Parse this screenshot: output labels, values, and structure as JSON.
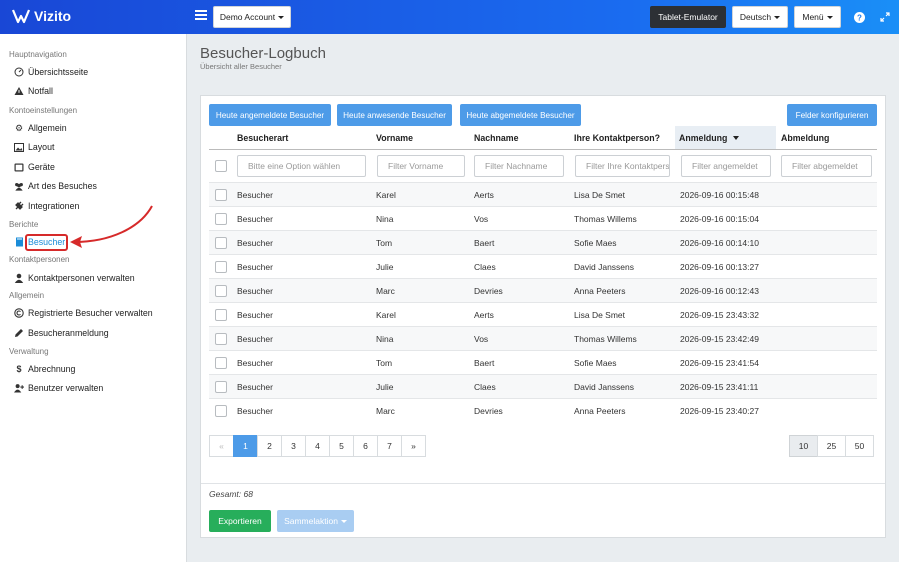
{
  "app": {
    "name": "Vizito"
  },
  "topbar": {
    "account_label": "Demo Account",
    "tablet_label": "Tablet-Emulator",
    "language_label": "Deutsch",
    "menu_label": "Menü",
    "help_icon": "help-icon",
    "expand_icon": "expand-icon"
  },
  "sidebar": {
    "sections": [
      {
        "title": "Hauptnavigation",
        "items": [
          {
            "label": "Übersichtsseite",
            "icon": "dashboard-icon"
          },
          {
            "label": "Notfall",
            "icon": "warning-icon"
          }
        ]
      },
      {
        "title": "Kontoeinstellungen",
        "items": [
          {
            "label": "Allgemein",
            "icon": "gear-icon"
          },
          {
            "label": "Layout",
            "icon": "image-icon"
          },
          {
            "label": "Geräte",
            "icon": "tablet-icon"
          },
          {
            "label": "Art des Besuches",
            "icon": "users-icon"
          },
          {
            "label": "Integrationen",
            "icon": "plug-icon"
          }
        ]
      },
      {
        "title": "Berichte",
        "items": [
          {
            "label": "Besucher",
            "icon": "book-icon",
            "active": true
          }
        ]
      },
      {
        "title": "Kontaktpersonen",
        "items": [
          {
            "label": "Kontaktpersonen verwalten",
            "icon": "user-icon"
          }
        ]
      },
      {
        "title": "Allgemein",
        "items": [
          {
            "label": "Registrierte Besucher verwalten",
            "icon": "copyright-icon"
          },
          {
            "label": "Besucheranmeldung",
            "icon": "pencil-icon"
          }
        ]
      },
      {
        "title": "Verwaltung",
        "items": [
          {
            "label": "Abrechnung",
            "icon": "dollar-icon"
          },
          {
            "label": "Benutzer verwalten",
            "icon": "user-plus-icon"
          }
        ]
      }
    ]
  },
  "page": {
    "title": "Besucher-Logbuch",
    "subtitle": "Übersicht aller Besucher"
  },
  "toolbar": {
    "today_registered": "Heute angemeldete Besucher",
    "today_present": "Heute anwesende Besucher",
    "today_checked_out": "Heute abgemeldete Besucher",
    "configure_fields": "Felder konfigurieren"
  },
  "table": {
    "columns": [
      "Besucherart",
      "Vorname",
      "Nachname",
      "Ihre Kontaktperson?",
      "Anmeldung",
      "Abmeldung"
    ],
    "sorted_column": "Anmeldung",
    "filters": {
      "besucherart": "Bitte eine Option wählen",
      "vorname": "Filter Vorname",
      "nachname": "Filter Nachname",
      "kontakt": "Filter Ihre Kontaktperson",
      "anmeldung": "Filter angemeldet",
      "abmeldung": "Filter abgemeldet"
    },
    "rows": [
      [
        "Besucher",
        "Karel",
        "Aerts",
        "Lisa De Smet",
        "2026-09-16 00:15:48",
        ""
      ],
      [
        "Besucher",
        "Nina",
        "Vos",
        "Thomas Willems",
        "2026-09-16 00:15:04",
        ""
      ],
      [
        "Besucher",
        "Tom",
        "Baert",
        "Sofie Maes",
        "2026-09-16 00:14:10",
        ""
      ],
      [
        "Besucher",
        "Julie",
        "Claes",
        "David Janssens",
        "2026-09-16 00:13:27",
        ""
      ],
      [
        "Besucher",
        "Marc",
        "Devries",
        "Anna Peeters",
        "2026-09-16 00:12:43",
        ""
      ],
      [
        "Besucher",
        "Karel",
        "Aerts",
        "Lisa De Smet",
        "2026-09-15 23:43:32",
        ""
      ],
      [
        "Besucher",
        "Nina",
        "Vos",
        "Thomas Willems",
        "2026-09-15 23:42:49",
        ""
      ],
      [
        "Besucher",
        "Tom",
        "Baert",
        "Sofie Maes",
        "2026-09-15 23:41:54",
        ""
      ],
      [
        "Besucher",
        "Julie",
        "Claes",
        "David Janssens",
        "2026-09-15 23:41:11",
        ""
      ],
      [
        "Besucher",
        "Marc",
        "Devries",
        "Anna Peeters",
        "2026-09-15 23:40:27",
        ""
      ]
    ]
  },
  "pagination": {
    "prev": "«",
    "next": "»",
    "pages": [
      "1",
      "2",
      "3",
      "4",
      "5",
      "6",
      "7"
    ],
    "current": "1",
    "page_sizes": [
      "10",
      "25",
      "50"
    ],
    "current_size": "10"
  },
  "footer": {
    "total": "Gesamt: 68",
    "export": "Exportieren",
    "bulk_action": "Sammelaktion"
  }
}
